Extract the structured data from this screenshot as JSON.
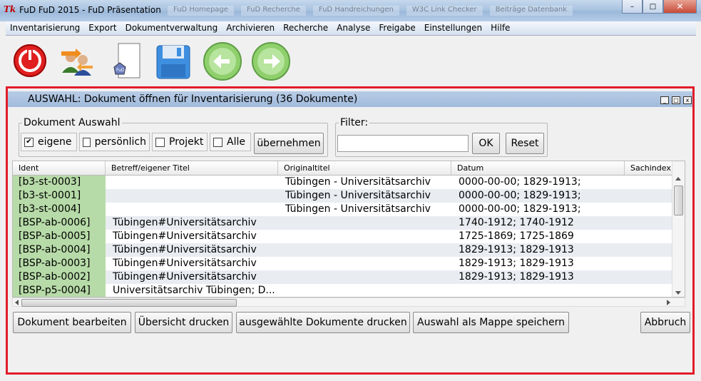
{
  "window": {
    "title": "FuD FuD 2015 - FuD Präsentation",
    "app_icon": "Tk",
    "background_tabs": [
      "FuD Homepage",
      "FuD Recherche",
      "FuD Handreichungen",
      "W3C Link Checker",
      "Beiträge Datenbank"
    ],
    "controls": {
      "minimize": "–",
      "maximize": "□",
      "close": "✕"
    }
  },
  "menu": [
    "Inventarisierung",
    "Export",
    "Dokumentverwaltung",
    "Archivieren",
    "Recherche",
    "Analyse",
    "Freigabe",
    "Einstellungen",
    "Hilfe"
  ],
  "toolbar": {
    "icons": [
      "power-exit-icon",
      "users-exchange-icon",
      "new-document-icon",
      "save-disk-icon",
      "arrow-back-icon",
      "arrow-forward-icon"
    ],
    "fud_badge": "FuD"
  },
  "panel": {
    "title": "AUSWAHL: Dokument öffnen für Inventarisierung (36 Dokumente)",
    "mini_controls": [
      "_",
      "□",
      "x"
    ]
  },
  "document_selection": {
    "legend": "Dokument Auswahl",
    "options": [
      {
        "label": "eigene",
        "checked": true,
        "mark": "✔"
      },
      {
        "label": "persönlich",
        "checked": false
      },
      {
        "label": "Projekt",
        "checked": false
      },
      {
        "label": "Alle",
        "checked": false
      }
    ],
    "apply_label": "übernehmen"
  },
  "filter": {
    "legend": "Filter:",
    "value": "",
    "ok_label": "OK",
    "reset_label": "Reset"
  },
  "table": {
    "columns": [
      "Ident",
      "Betreff/eigener Titel",
      "Originaltitel",
      "Datum",
      "Sachindex"
    ],
    "rows": [
      [
        "[b3-st-0003]",
        "",
        "Tübingen - Universitätsarchiv",
        "0000-00-00; 1829-1913;"
      ],
      [
        "[b3-st-0001]",
        "",
        "Tübingen - Universitätsarchiv",
        "0000-00-00; 1829-1913;"
      ],
      [
        "[b3-st-0004]",
        "",
        "Tübingen - Universitätsarchiv",
        "0000-00-00; 1829-1913;"
      ],
      [
        "[BSP-ab-0006]",
        "Tübingen#Universitätsarchiv",
        "",
        "1740-1912; 1740-1912"
      ],
      [
        "[BSP-ab-0005]",
        "Tübingen#Universitätsarchiv",
        "",
        "1725-1869; 1725-1869"
      ],
      [
        "[BSP-ab-0004]",
        "Tübingen#Universitätsarchiv",
        "",
        "1829-1913; 1829-1913"
      ],
      [
        "[BSP-ab-0003]",
        "Tübingen#Universitätsarchiv",
        "",
        "1829-1913; 1829-1913"
      ],
      [
        "[BSP-ab-0002]",
        "Tübingen#Universitätsarchiv",
        "",
        "1829-1913; 1829-1913"
      ],
      [
        "[BSP-p5-0004]",
        "Universitätsarchiv Tübingen; D...",
        "",
        ""
      ]
    ]
  },
  "actions": {
    "edit": "Dokument bearbeiten",
    "print_overview": "Übersicht drucken",
    "print_selected": "ausgewählte Dokumente drucken",
    "save_as_folder": "Auswahl als Mappe speichern",
    "cancel": "Abbruch"
  },
  "colors": {
    "frame_red": "#e21c2a",
    "ident_green": "#b7dba8",
    "panel_header": "#a9c2e0"
  }
}
